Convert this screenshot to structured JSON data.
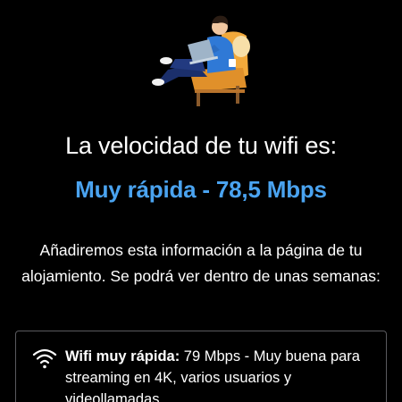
{
  "result": {
    "headline": "La velocidad de tu wifi es:",
    "speed_text": "Muy rápida - 78,5 Mbps",
    "speed_color": "#4aa3f0",
    "info_text": "Añadiremos esta información a la página de tu alojamiento. Se podrá ver dentro de unas semanas:"
  },
  "card": {
    "icon": "wifi-icon",
    "title": "Wifi muy rápida:",
    "description": " 79 Mbps - Muy buena para streaming en 4K, varios usuarios y videollamadas"
  }
}
